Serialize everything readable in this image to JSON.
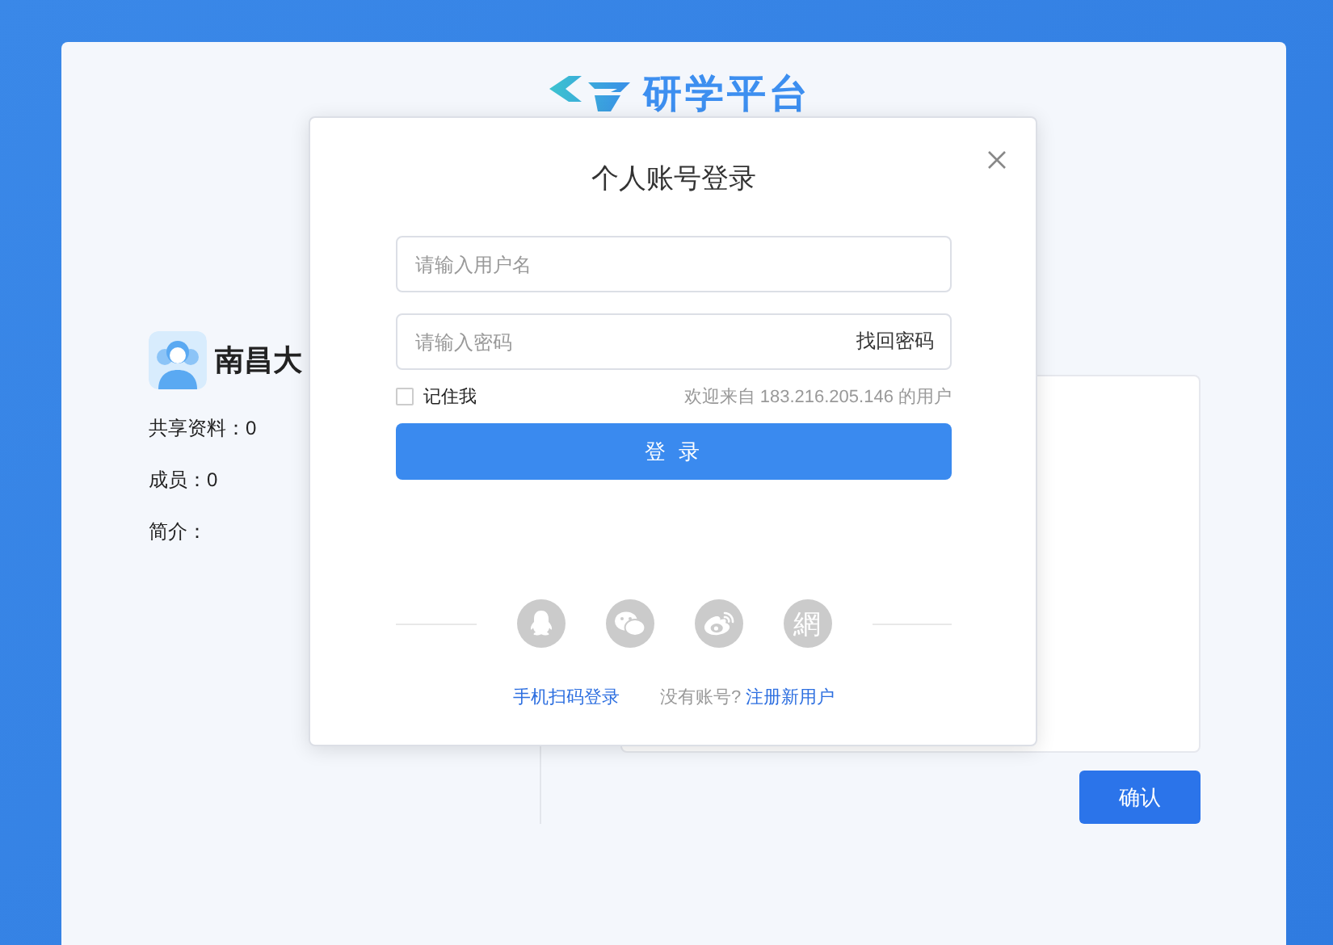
{
  "logo": {
    "text": "研学平台"
  },
  "profile": {
    "name": "南昌大",
    "stats": [
      "共享资料：0",
      "成员：0",
      "简介："
    ]
  },
  "confirm_button": "确认",
  "login_dialog": {
    "title": "个人账号登录",
    "username": {
      "placeholder": "请输入用户名"
    },
    "password": {
      "placeholder": "请输入密码",
      "link": "找回密码"
    },
    "remember": {
      "label": "记住我",
      "checked": false
    },
    "welcome": "欢迎来自 183.216.205.146 的用户",
    "login_button": "登 录",
    "social": [
      {
        "kind": "qq"
      },
      {
        "kind": "wechat"
      },
      {
        "kind": "weibo"
      },
      {
        "kind": "text",
        "text": "網"
      }
    ],
    "scan_link": "手机扫码登录",
    "no_account": "没有账号?",
    "register_link": "注册新用户"
  }
}
